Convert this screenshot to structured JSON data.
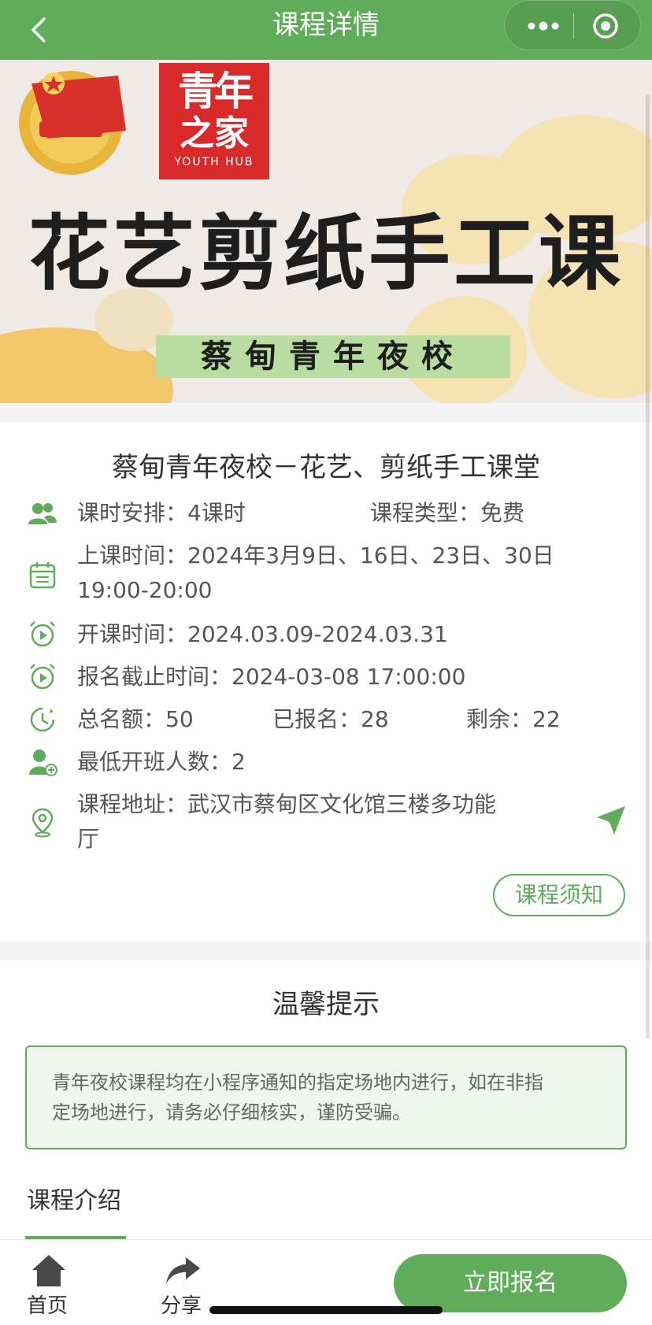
{
  "nav": {
    "title": "课程详情",
    "back_icon": "chevron-left-icon",
    "more_icon": "more-dots-icon",
    "close_icon": "target-circle-icon"
  },
  "banner": {
    "hub_logo_line1": "青年",
    "hub_logo_line2": "之家",
    "hub_logo_english": "YOUTH HUB",
    "title": "花艺剪纸手工课",
    "subtitle": "蔡甸青年夜校"
  },
  "course": {
    "title": "蔡甸青年夜校－花艺、剪纸手工课堂",
    "hours_label": "课时安排：",
    "hours_value": "4课时",
    "type_label": "课程类型：",
    "type_value": "免费",
    "class_time_label": "上课时间：",
    "class_time_dates": "2024年3月9日、16日、23日、30日",
    "class_time_hours": "19:00-20:00",
    "start_label": "开课时间：",
    "start_value": "2024.03.09-2024.03.31",
    "deadline_label": "报名截止时间：",
    "deadline_value": "2024-03-08 17:00:00",
    "quota_label": "总名额：",
    "quota_value": "50",
    "signed_label": "已报名：",
    "signed_value": "28",
    "remaining_label": "剩余：",
    "remaining_value": "22",
    "min_label": "最低开班人数：",
    "min_value": "2",
    "address_label": "课程地址：",
    "address_line1": "武汉市蔡甸区文化馆三楼多功能",
    "address_line2": "厅",
    "notice_button": "课程须知"
  },
  "tip": {
    "heading": "温馨提示",
    "line1": "青年夜校课程均在小程序通知的指定场地内进行，如在非指",
    "line2": "定场地进行，请务必仔细核实，谨防受骗。"
  },
  "intro": {
    "tab_label": "课程介绍"
  },
  "tabbar": {
    "home_label": "首页",
    "share_label": "分享",
    "signup_label": "立即报名"
  },
  "colors": {
    "brand_green": "#5fac5a",
    "logo_red": "#d82a2a",
    "tip_bg": "#eef6ee"
  }
}
